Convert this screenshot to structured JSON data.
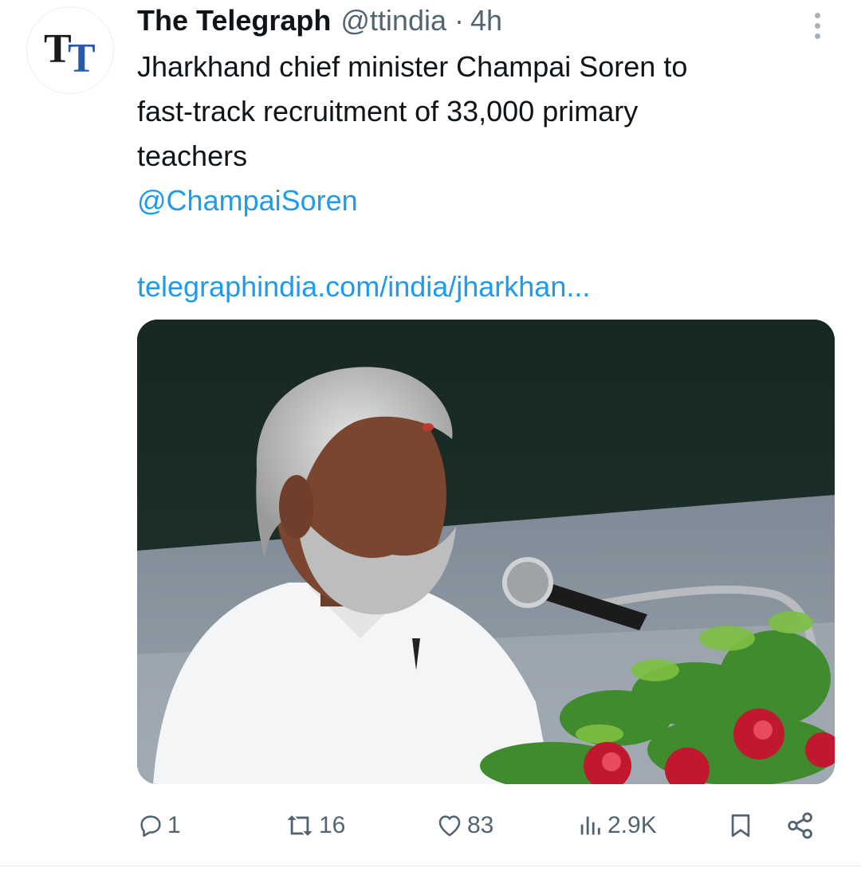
{
  "tweet": {
    "author_name": "The Telegraph",
    "handle": "@ttindia",
    "separator": "·",
    "time": "4h",
    "avatar_text": "TT",
    "text_lines": [
      "Jharkhand chief minister Champai Soren to",
      "fast-track recruitment of 33,000 primary",
      "teachers"
    ],
    "mention": "@ChampaiSoren",
    "link": "telegraphindia.com/india/jharkhan...",
    "image_alt": "Champai Soren speaking at a microphone with flowers in front"
  },
  "actions": {
    "reply_count": "1",
    "retweet_count": "16",
    "like_count": "83",
    "views_count": "2.9K"
  },
  "icons": {
    "more": "more-vertical-icon",
    "reply": "reply-icon",
    "retweet": "retweet-icon",
    "like": "heart-icon",
    "views": "views-icon",
    "bookmark": "bookmark-icon",
    "share": "share-icon"
  },
  "colors": {
    "link": "#1d9bf0",
    "secondary_text": "#536471",
    "primary_text": "#0f1419",
    "avatar_blue": "#2a5aa3"
  }
}
